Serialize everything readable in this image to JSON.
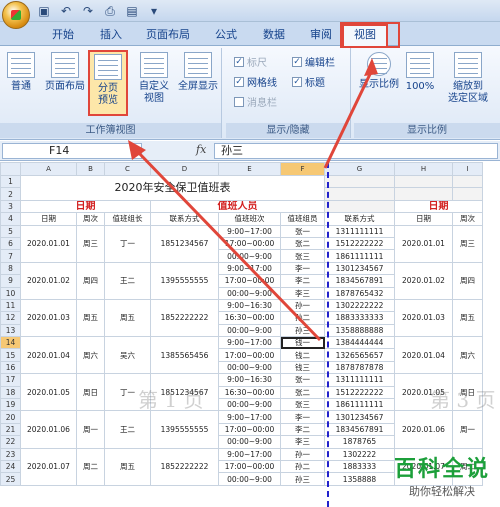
{
  "tabs": [
    "开始",
    "插入",
    "页面布局",
    "公式",
    "数据",
    "审阅",
    "视图"
  ],
  "ribbon": {
    "normal": "普通",
    "page_layout": "页面布局",
    "page_break_1": "分页",
    "page_break_2": "预览",
    "custom_1": "自定义",
    "custom_2": "视图",
    "fullscreen": "全屏显示",
    "group_workbook_views": "工作簿视图",
    "ruler": "标尺",
    "gridlines": "网格线",
    "message_bar": "消息栏",
    "formula_bar": "编辑栏",
    "headings": "标题",
    "group_show_hide": "显示/隐藏",
    "zoom": "显示比例",
    "zoom_100": "100%",
    "zoom_selection_1": "缩放到",
    "zoom_selection_2": "选定区域",
    "group_zoom": "显示比例"
  },
  "formula": {
    "cell": "F14",
    "fx": "fx",
    "value": "孙三"
  },
  "columns": [
    "A",
    "B",
    "C",
    "D",
    "E",
    "F",
    "G",
    "H",
    "I"
  ],
  "sheet": {
    "title": "2020年安全保卫值班表",
    "section_date": "日期",
    "section_staff": "值班人员",
    "headers": [
      "日期",
      "周次",
      "值班组长",
      "联系方式",
      "值班班次",
      "值班组员",
      "联系方式",
      "日期",
      "周次"
    ],
    "rows": [
      [
        "2020.01.01",
        "周三",
        "丁一",
        "1851234567",
        "9:00~17:00",
        "张一",
        "1311111111",
        "2020.01.01",
        "周三"
      ],
      [
        "",
        "",
        "",
        "",
        "17:00~00:00",
        "张二",
        "1512222222",
        "",
        ""
      ],
      [
        "",
        "",
        "",
        "",
        "00:00~9:00",
        "张三",
        "1861111111",
        "",
        ""
      ],
      [
        "2020.01.02",
        "周四",
        "王二",
        "1395555555",
        "9:00~17:00",
        "李一",
        "1301234567",
        "2020.01.02",
        "周四"
      ],
      [
        "",
        "",
        "",
        "",
        "17:00~00:00",
        "李二",
        "1834567891",
        "",
        ""
      ],
      [
        "",
        "",
        "",
        "",
        "00:00~9:00",
        "李三",
        "1878765432",
        "",
        ""
      ],
      [
        "2020.01.03",
        "周五",
        "周五",
        "1852222222",
        "9:00~16:30",
        "孙一",
        "1302222222",
        "2020.01.03",
        "周五"
      ],
      [
        "",
        "",
        "",
        "",
        "16:30~00:00",
        "孙二",
        "1883333333",
        "",
        ""
      ],
      [
        "",
        "",
        "",
        "",
        "00:00~9:00",
        "孙三",
        "1358888888",
        "",
        ""
      ],
      [
        "2020.01.04",
        "周六",
        "吴六",
        "1385565456",
        "9:00~17:00",
        "钱一",
        "1384444444",
        "2020.01.04",
        "周六"
      ],
      [
        "",
        "",
        "",
        "",
        "17:00~00:00",
        "钱二",
        "1326565657",
        "",
        ""
      ],
      [
        "",
        "",
        "",
        "",
        "00:00~9:00",
        "钱三",
        "1878787878",
        "",
        ""
      ],
      [
        "2020.01.05",
        "周日",
        "丁一",
        "1851234567",
        "9:00~16:30",
        "张一",
        "1311111111",
        "2020.01.05",
        "周日"
      ],
      [
        "",
        "",
        "",
        "",
        "16:30~00:00",
        "张二",
        "1512222222",
        "",
        ""
      ],
      [
        "",
        "",
        "",
        "",
        "00:00~9:00",
        "张三",
        "1861111111",
        "",
        ""
      ],
      [
        "2020.01.06",
        "周一",
        "王二",
        "1395555555",
        "9:00~17:00",
        "李一",
        "1301234567",
        "2020.01.06",
        "周一"
      ],
      [
        "",
        "",
        "",
        "",
        "17:00~00:00",
        "李二",
        "1834567891",
        "",
        ""
      ],
      [
        "",
        "",
        "",
        "",
        "00:00~9:00",
        "李三",
        "1878765",
        "",
        ""
      ],
      [
        "2020.01.07",
        "周二",
        "周五",
        "1852222222",
        "9:00~17:00",
        "孙一",
        "1302222",
        "2020.01.07",
        "周二"
      ],
      [
        "",
        "",
        "",
        "",
        "17:00~00:00",
        "孙二",
        "1883333",
        "",
        ""
      ],
      [
        "",
        "",
        "",
        "",
        "00:00~9:00",
        "孙三",
        "1358888",
        "",
        ""
      ]
    ]
  },
  "watermark_left": "第 1 页",
  "watermark_right": "第 3 页",
  "brand": {
    "name": "百科全说",
    "slogan": "助你轻松解决"
  }
}
